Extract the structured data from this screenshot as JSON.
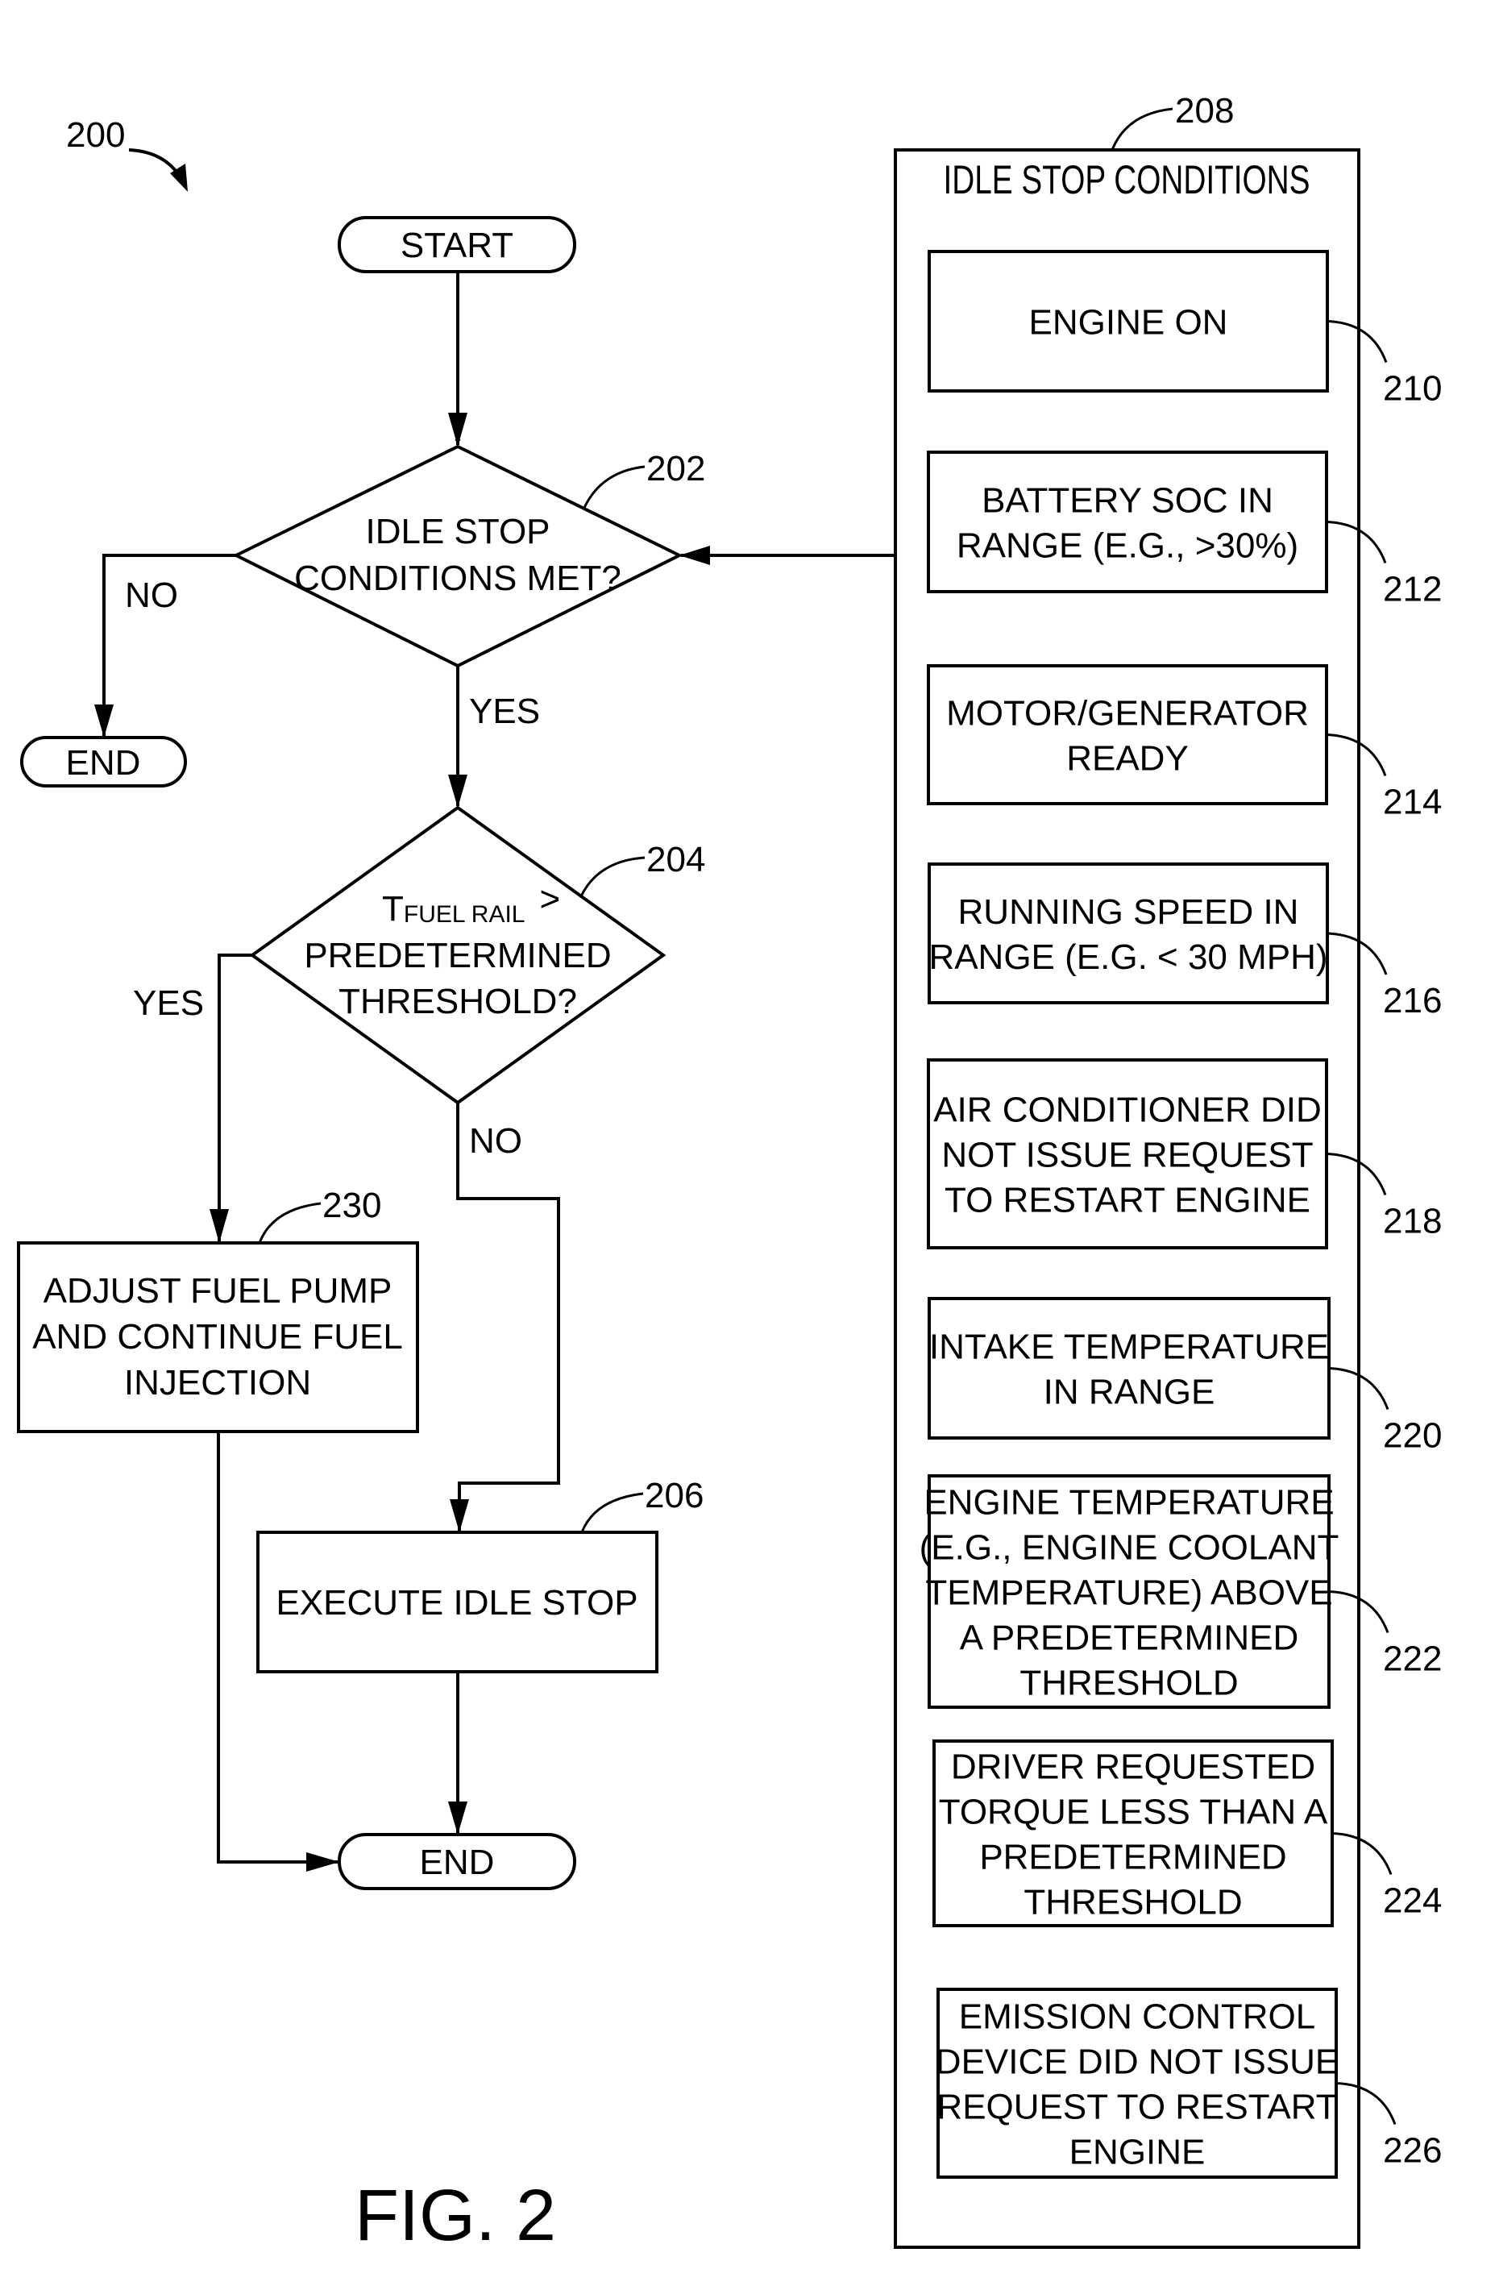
{
  "figure": {
    "label": "FIG. 2",
    "ref": "200"
  },
  "colors": {
    "ink": "#000000",
    "paper": "#ffffff"
  },
  "flow": {
    "start": {
      "label": "START"
    },
    "decision_202": {
      "ref": "202",
      "lines": [
        "IDLE STOP",
        "CONDITIONS MET?"
      ]
    },
    "decision_202_no": "NO",
    "decision_202_yes": "YES",
    "end_no": {
      "label": "END"
    },
    "decision_204": {
      "ref": "204",
      "symbol": "T",
      "subscript": "FUEL RAIL",
      "operator": ">",
      "lines": [
        "PREDETERMINED",
        "THRESHOLD?"
      ]
    },
    "decision_204_yes": "YES",
    "decision_204_no": "NO",
    "step_230": {
      "ref": "230",
      "lines": [
        "ADJUST FUEL PUMP",
        "AND CONTINUE FUEL",
        "INJECTION"
      ]
    },
    "step_206": {
      "ref": "206",
      "lines": [
        "EXECUTE IDLE STOP"
      ]
    },
    "end_final": {
      "label": "END"
    }
  },
  "conditions_panel": {
    "ref": "208",
    "title": "IDLE STOP CONDITIONS",
    "items": [
      {
        "ref": "210",
        "lines": [
          "ENGINE ON"
        ]
      },
      {
        "ref": "212",
        "lines": [
          "BATTERY SOC IN",
          "RANGE (E.G., >30%)"
        ]
      },
      {
        "ref": "214",
        "lines": [
          "MOTOR/GENERATOR",
          "READY"
        ]
      },
      {
        "ref": "216",
        "lines": [
          "RUNNING SPEED IN",
          "RANGE (E.G. < 30 MPH)"
        ]
      },
      {
        "ref": "218",
        "lines": [
          "AIR CONDITIONER DID",
          "NOT ISSUE REQUEST",
          "TO RESTART ENGINE"
        ]
      },
      {
        "ref": "220",
        "lines": [
          "INTAKE TEMPERATURE",
          "IN RANGE"
        ]
      },
      {
        "ref": "222",
        "lines": [
          "ENGINE TEMPERATURE",
          "(E.G., ENGINE COOLANT",
          "TEMPERATURE) ABOVE",
          "A  PREDETERMINED",
          "THRESHOLD"
        ]
      },
      {
        "ref": "224",
        "lines": [
          "DRIVER REQUESTED",
          "TORQUE LESS THAN A",
          "PREDETERMINED",
          "THRESHOLD"
        ]
      },
      {
        "ref": "226",
        "lines": [
          "EMISSION CONTROL",
          "DEVICE DID NOT ISSUE",
          "REQUEST TO RESTART",
          "ENGINE"
        ]
      }
    ]
  }
}
